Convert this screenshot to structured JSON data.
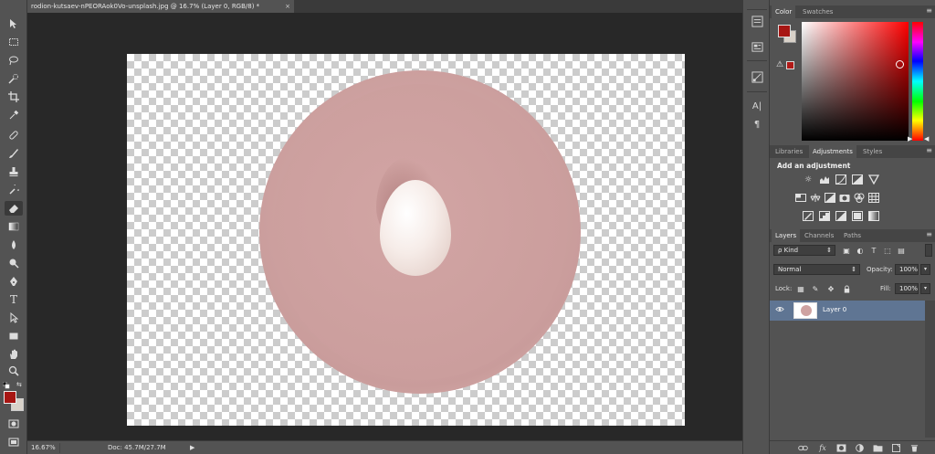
{
  "document": {
    "tab_title": "rodion-kutsaev-nPEORAok0Vo-unsplash.jpg @ 16.7% (Layer 0, RGB/8) *",
    "close_glyph": "×"
  },
  "toolbar": {
    "tools": [
      "move-tool",
      "marquee-tool",
      "lasso-tool",
      "quick-selection-tool",
      "crop-tool",
      "eyedropper-tool",
      "healing-brush-tool",
      "brush-tool",
      "clone-stamp-tool",
      "history-brush-tool",
      "eraser-tool",
      "gradient-tool",
      "blur-tool",
      "dodge-tool",
      "pen-tool",
      "type-tool",
      "path-selection-tool",
      "rectangle-tool",
      "hand-tool",
      "zoom-tool"
    ],
    "type_glyph": "T",
    "foreground_color": "#a71613",
    "background_color": "#d9d2c9"
  },
  "status": {
    "zoom": "16.67%",
    "doc_size": "Doc: 45.7M/27.7M",
    "arrow": "▶"
  },
  "icon_strip": {
    "items": [
      "history-icon",
      "properties-icon",
      "paths-icon",
      "character-icon",
      "paragraph-icon"
    ],
    "character_glyph": "A|",
    "paragraph_glyph": "¶"
  },
  "color_panel": {
    "tabs": [
      "Color",
      "Swatches"
    ],
    "menu_glyph": "≡",
    "foreground_color": "#a71613",
    "background_color": "#d9d2c9",
    "warning_glyph": "⚠",
    "hue": "red"
  },
  "adjustments_panel": {
    "tabs": [
      "Libraries",
      "Adjustments",
      "Styles"
    ],
    "heading": "Add an adjustment"
  },
  "layers_panel": {
    "tabs": [
      "Layers",
      "Channels",
      "Paths"
    ],
    "filter_label": "ρ Kind",
    "blend_mode": "Normal",
    "opacity_label": "Opacity:",
    "opacity_value": "100%",
    "lock_label": "Lock:",
    "fill_label": "Fill:",
    "fill_value": "100%",
    "layers": [
      {
        "name": "Layer 0",
        "visible": true,
        "selected": true
      }
    ],
    "bottom_icons": [
      "link-icon",
      "fx-icon",
      "mask-icon",
      "adjustment-layer-icon",
      "group-icon",
      "new-layer-icon",
      "trash-icon"
    ],
    "fx_glyph": "fx"
  }
}
